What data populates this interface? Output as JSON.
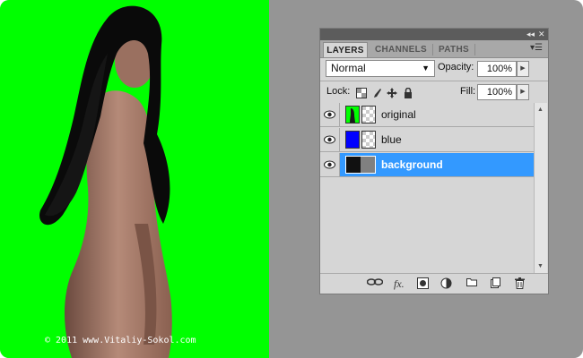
{
  "canvas": {
    "background": "#00ff00",
    "copyright": "© 2011 www.Vitaliy-Sokol.com"
  },
  "panel": {
    "titlebar": {
      "collapse_icon": "double-left-arrow-icon",
      "close_icon": "close-icon"
    },
    "tabs": [
      {
        "label": "LAYERS",
        "active": true
      },
      {
        "label": "CHANNELS",
        "active": false
      },
      {
        "label": "PATHS",
        "active": false
      }
    ],
    "blend_mode": "Normal",
    "opacity_label": "Opacity:",
    "opacity_value": "100%",
    "lock_label": "Lock:",
    "fill_label": "Fill:",
    "fill_value": "100%",
    "layers": [
      {
        "name": "original",
        "visible": true,
        "selected": false
      },
      {
        "name": "blue",
        "visible": true,
        "selected": false
      },
      {
        "name": "background",
        "visible": true,
        "selected": true
      }
    ],
    "footer_icons": [
      "link-icon",
      "fx-icon",
      "mask-icon",
      "adjustment-icon",
      "folder-icon",
      "new-layer-icon",
      "trash-icon"
    ],
    "colors": {
      "selected_row": "#3399ff",
      "blue_layer": "#0000ff"
    }
  }
}
